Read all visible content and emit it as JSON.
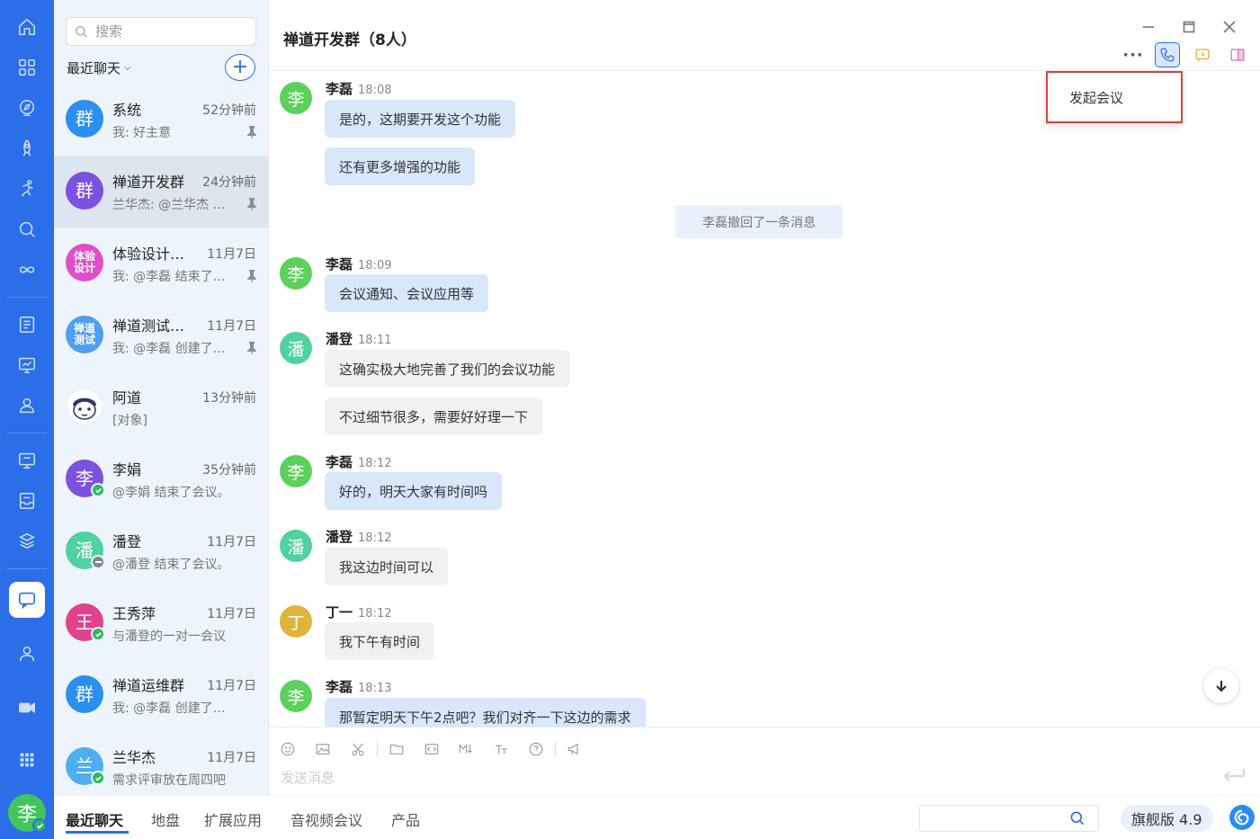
{
  "colors": {
    "accent": "#2b6ee8",
    "online": "#2cba5a",
    "popup_border": "#d9413a"
  },
  "rail": {
    "icons": [
      "home-icon",
      "apps-grid-icon",
      "compass-icon",
      "rocket-icon",
      "runner-icon",
      "search-magnifier-icon",
      "infinity-icon",
      "document-list-icon",
      "monitor-chart-icon",
      "users-icon",
      "oa-screen-icon",
      "inbox-icon",
      "cube-stack-icon",
      "chat-icon",
      "contact-icon",
      "video-icon",
      "grid-dots-icon"
    ],
    "active": "chat-icon",
    "me_avatar": "李"
  },
  "sidebar": {
    "search_placeholder": "搜索",
    "filter_label": "最近聊天",
    "add_label": "+",
    "conversations": [
      {
        "avatar": "群",
        "avatar_color": "#2b8ff0",
        "name": "系统",
        "time": "52分钟前",
        "preview": "我: 好主意",
        "pinned": true
      },
      {
        "avatar": "群",
        "avatar_color": "#7b52e0",
        "name": "禅道开发群",
        "time": "24分钟前",
        "preview": "兰华杰: @兰华杰 …",
        "pinned": true,
        "active": true
      },
      {
        "avatar": "体验\n设计",
        "avatar_color": "#e04fc8",
        "name": "体验设计…",
        "time": "11月7日",
        "preview": "我: @李磊 结束了…",
        "pinned": true
      },
      {
        "avatar": "禅道\n测试",
        "avatar_color": "#4f9ef0",
        "name": "禅道测试…",
        "time": "11月7日",
        "preview": "我: @李磊 创建了…",
        "pinned": true
      },
      {
        "avatar": "",
        "avatar_color": "#ffffff",
        "name": "阿道",
        "time": "13分钟前",
        "preview": "[对象]",
        "pinned": false
      },
      {
        "avatar": "李",
        "avatar_color": "#7b52e0",
        "name": "李娟",
        "time": "35分钟前",
        "preview": "@李娟 结束了会议。",
        "pinned": false,
        "status": "online"
      },
      {
        "avatar": "潘",
        "avatar_color": "#4fd2a0",
        "name": "潘登",
        "time": "11月7日",
        "preview": "@潘登 结束了会议。",
        "pinned": false,
        "status": "away"
      },
      {
        "avatar": "王",
        "avatar_color": "#e0438c",
        "name": "王秀萍",
        "time": "11月7日",
        "preview": "与潘登的一对一会议",
        "pinned": false,
        "status": "online"
      },
      {
        "avatar": "群",
        "avatar_color": "#2b8ff0",
        "name": "禅道运维群",
        "time": "11月7日",
        "preview": "我: @李磊 创建了讨…",
        "pinned": false
      },
      {
        "avatar": "兰",
        "avatar_color": "#4faef0",
        "name": "兰华杰",
        "time": "11月7日",
        "preview": "需求评审放在周四吧",
        "pinned": false,
        "status": "online"
      }
    ]
  },
  "chat": {
    "title": "禅道开发群（8人）",
    "more_label": "···",
    "popup_item": "发起会议",
    "recall_notice": "李磊撤回了一条消息",
    "messages": [
      {
        "sender": "李磊",
        "avatar": "李",
        "avatar_color": "#5bd15b",
        "time": "18:08",
        "mine": true,
        "bubbles": [
          "是的，这期要开发这个功能",
          "还有更多增强的功能"
        ]
      },
      {
        "sender": "李磊",
        "avatar": "李",
        "avatar_color": "#5bd15b",
        "time": "18:09",
        "mine": true,
        "bubbles": [
          "会议通知、会议应用等"
        ]
      },
      {
        "sender": "潘登",
        "avatar": "潘",
        "avatar_color": "#4fd2a0",
        "time": "18:11",
        "mine": false,
        "bubbles": [
          "这确实极大地完善了我们的会议功能",
          "不过细节很多，需要好好理一下"
        ]
      },
      {
        "sender": "李磊",
        "avatar": "李",
        "avatar_color": "#5bd15b",
        "time": "18:12",
        "mine": true,
        "bubbles": [
          "好的，明天大家有时间吗"
        ]
      },
      {
        "sender": "潘登",
        "avatar": "潘",
        "avatar_color": "#4fd2a0",
        "time": "18:12",
        "mine": false,
        "bubbles": [
          "我这边时间可以"
        ]
      },
      {
        "sender": "丁一",
        "avatar": "丁",
        "avatar_color": "#e0b43c",
        "time": "18:12",
        "mine": false,
        "bubbles": [
          "我下午有时间"
        ]
      },
      {
        "sender": "李磊",
        "avatar": "李",
        "avatar_color": "#5bd15b",
        "time": "18:13",
        "mine": true,
        "bubbles": [
          "那暂定明天下午2点吧？我们对齐一下这边的需求"
        ]
      }
    ],
    "composer": {
      "placeholder": "发送消息",
      "tools": [
        "emoji-icon",
        "image-icon",
        "scissors-icon",
        "folder-icon",
        "code-icon",
        "markdown-icon",
        "text-format-icon",
        "help-icon",
        "megaphone-icon"
      ]
    }
  },
  "bottombar": {
    "tabs": [
      "最近聊天",
      "地盘",
      "扩展应用",
      "音视频会议",
      "产品"
    ],
    "active_tab": "最近聊天",
    "version": "旗舰版 4.9"
  }
}
